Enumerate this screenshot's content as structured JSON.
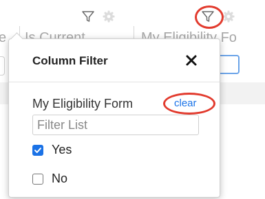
{
  "grid": {
    "columns": [
      {
        "title": "e"
      },
      {
        "title": "Is Current"
      },
      {
        "title": "My Eligibility Fo"
      }
    ]
  },
  "icons": {
    "filter": "funnel-icon",
    "settings": "gear-icon",
    "close": "close-icon",
    "check": "check-icon"
  },
  "popup": {
    "title": "Column Filter",
    "field_label": "My Eligibility Form",
    "clear_label": "clear",
    "search": {
      "placeholder": "Filter List",
      "value": ""
    },
    "options": [
      {
        "label": "Yes",
        "checked": true
      },
      {
        "label": "No",
        "checked": false
      }
    ]
  },
  "colors": {
    "accent": "#1b72e6",
    "link": "#1a73e8",
    "annotation": "#e23b2e",
    "active_input_border": "#6aa3e8"
  }
}
